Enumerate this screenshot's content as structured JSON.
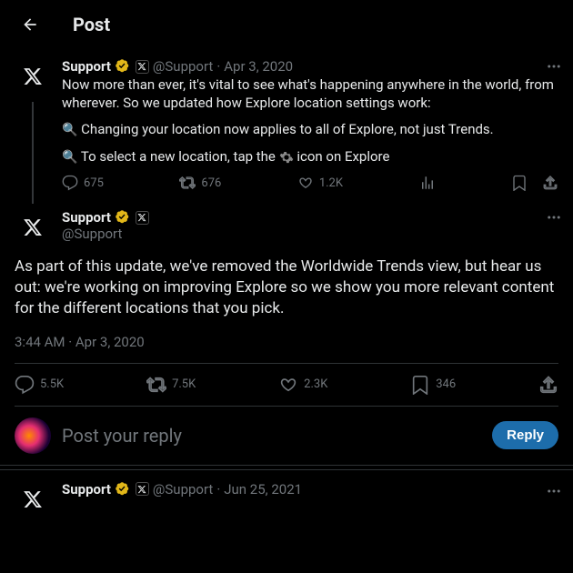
{
  "header": {
    "title": "Post"
  },
  "parent": {
    "name": "Support",
    "handle": "@Support",
    "date": "Apr 3, 2020",
    "line1": "Now more than ever, it's vital to see what's happening anywhere in the world, from wherever. So we updated how Explore location settings work:",
    "point1": "Changing your location now applies to all of Explore, not just Trends.",
    "point2_a": "To select a new location, tap the ",
    "point2_b": " icon on Explore",
    "replies": "675",
    "retweets": "676",
    "likes": "1.2K"
  },
  "main": {
    "name": "Support",
    "handle": "@Support",
    "body": "As part of this update, we've removed the Worldwide Trends view, but hear us out: we're working on improving Explore so we show you more relevant content for the different locations that you pick.",
    "timestamp": "3:44 AM · Apr 3, 2020",
    "replies": "5.5K",
    "retweets": "7.5K",
    "likes": "2.3K",
    "bookmarks": "346"
  },
  "reply": {
    "placeholder": "Post your reply",
    "button": "Reply"
  },
  "thread": {
    "name": "Support",
    "handle": "@Support",
    "date": "Jun 25, 2021"
  }
}
